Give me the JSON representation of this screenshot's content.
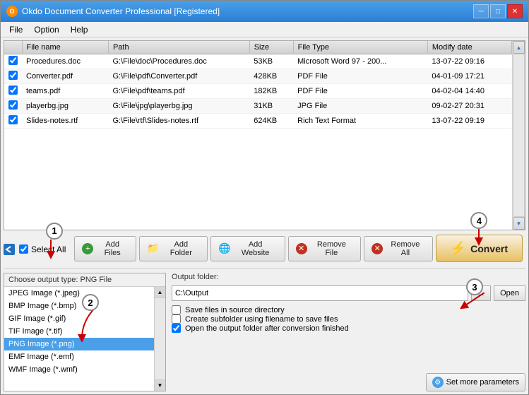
{
  "window": {
    "title": "Okdo Document Converter Professional [Registered]",
    "icon": "O"
  },
  "titlebar": {
    "minimize": "─",
    "maximize": "□",
    "close": "✕"
  },
  "menu": {
    "items": [
      {
        "label": "File"
      },
      {
        "label": "Option"
      },
      {
        "label": "Help"
      }
    ]
  },
  "table": {
    "columns": [
      {
        "key": "check",
        "label": ""
      },
      {
        "key": "name",
        "label": "File name"
      },
      {
        "key": "path",
        "label": "Path"
      },
      {
        "key": "size",
        "label": "Size"
      },
      {
        "key": "type",
        "label": "File Type"
      },
      {
        "key": "date",
        "label": "Modify date"
      }
    ],
    "rows": [
      {
        "checked": true,
        "name": "Procedures.doc",
        "path": "G:\\File\\doc\\Procedures.doc",
        "size": "53KB",
        "type": "Microsoft Word 97 - 200...",
        "date": "13-07-22 09:16"
      },
      {
        "checked": true,
        "name": "Converter.pdf",
        "path": "G:\\File\\pdf\\Converter.pdf",
        "size": "428KB",
        "type": "PDF File",
        "date": "04-01-09 17:21"
      },
      {
        "checked": true,
        "name": "teams.pdf",
        "path": "G:\\File\\pdf\\teams.pdf",
        "size": "182KB",
        "type": "PDF File",
        "date": "04-02-04 14:40"
      },
      {
        "checked": true,
        "name": "playerbg.jpg",
        "path": "G:\\File\\jpg\\playerbg.jpg",
        "size": "31KB",
        "type": "JPG File",
        "date": "09-02-27 20:31"
      },
      {
        "checked": true,
        "name": "Slides-notes.rtf",
        "path": "G:\\File\\rtf\\Slides-notes.rtf",
        "size": "624KB",
        "type": "Rich Text Format",
        "date": "13-07-22 09:19"
      }
    ]
  },
  "selectAll": {
    "label": "Select All",
    "checked": true
  },
  "toolbar": {
    "addFiles": "Add Files",
    "addFolder": "Add Folder",
    "addWebsite": "Add Website",
    "removeFile": "Remove File",
    "removeAll": "Remove All",
    "convert": "Convert"
  },
  "outputType": {
    "header": "Choose output type:  PNG File",
    "formats": [
      {
        "label": "JPEG Image (*.jpeg)",
        "selected": false
      },
      {
        "label": "BMP Image (*.bmp)",
        "selected": false
      },
      {
        "label": "GIF Image (*.gif)",
        "selected": false
      },
      {
        "label": "TIF Image (*.tif)",
        "selected": false
      },
      {
        "label": "PNG Image (*.png)",
        "selected": true
      },
      {
        "label": "EMF Image (*.emf)",
        "selected": false
      },
      {
        "label": "WMF Image (*.wmf)",
        "selected": false
      }
    ]
  },
  "outputFolder": {
    "label": "Output folder:",
    "path": "C:\\Output",
    "browseLabel": "...",
    "openLabel": "Open",
    "options": [
      {
        "label": "Save files in source directory",
        "checked": false
      },
      {
        "label": "Create subfolder using filename to save files",
        "checked": false
      },
      {
        "label": "Open the output folder after conversion finished",
        "checked": true
      }
    ],
    "setMoreParams": "Set more parameters"
  },
  "annotations": {
    "1": "1",
    "2": "2",
    "3": "3",
    "4": "4"
  }
}
